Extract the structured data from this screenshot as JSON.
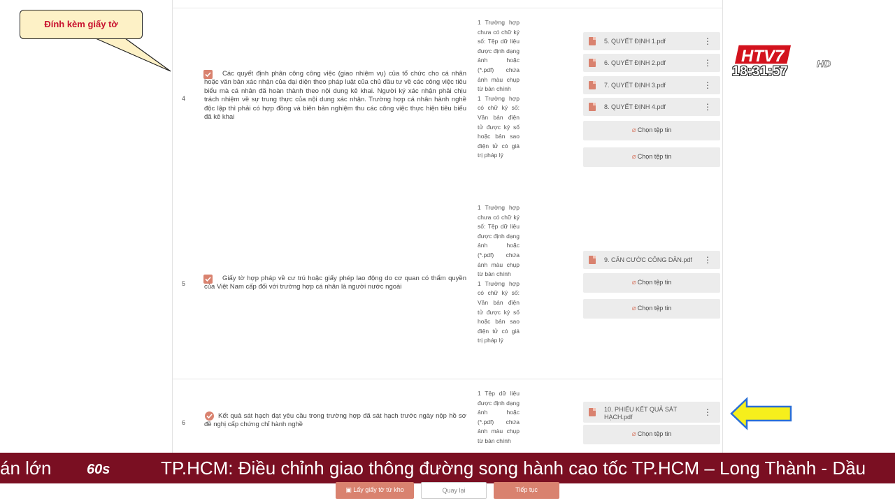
{
  "callout": {
    "label": "Đính kèm giấy tờ"
  },
  "channel": {
    "logo_text": "HTV7",
    "logo_suffix": "HD",
    "clock": "18:31:57"
  },
  "rows": [
    {
      "index": "4",
      "description": "Các quyết định phân công công việc (giao nhiệm vụ) của tổ chức cho cá nhân hoặc văn bản xác nhận của đại diện theo pháp luật của chủ đầu tư về các công việc tiêu biểu mà cá nhân đã hoàn thành theo nội dung kê khai. Người ký xác nhận phải chịu trách nhiệm về sự trung thực của nội dung xác nhận. Trường hợp cá nhân hành nghề độc lập thì phải có hợp đồng và biên bản nghiệm thu các công việc thực hiện tiêu biểu đã kê khai",
      "requirements": "1 Trường hợp chưa có chữ ký số: Tệp dữ liệu được định dạng ảnh hoặc (*.pdf) chứa ảnh màu chụp từ bản chính\n1 Trường hợp có chữ ký số: Văn bản điện tử được ký số hoặc bản sao điện tử có giá trị pháp lý",
      "files": [
        "5. QUYẾT ĐỊNH 1.pdf",
        "6. QUYẾT ĐỊNH 2.pdf",
        "7. QUYẾT ĐỊNH 3.pdf",
        "8. QUYẾT ĐỊNH 4.pdf"
      ],
      "choose_buttons": [
        "Chọn tệp tin",
        "Chọn tệp tin"
      ]
    },
    {
      "index": "5",
      "description": "Giấy tờ hợp pháp về cư trú hoặc giấy phép lao động do cơ quan có thẩm quyền của Việt Nam cấp đối với trường hợp cá nhân là người nước ngoài",
      "requirements": "1 Trường hợp chưa có chữ ký số: Tệp dữ liệu được định dạng ảnh hoặc (*.pdf) chứa ảnh màu chụp từ bản chính\n1 Trường hợp có chữ ký số: Văn bản điện tử được ký số hoặc bản sao điện tử có giá trị pháp lý",
      "files": [
        "9. CĂN CƯỚC CÔNG DÂN.pdf"
      ],
      "choose_buttons": [
        "Chọn tệp tin",
        "Chọn tệp tin"
      ]
    },
    {
      "index": "6",
      "description": "Kết quả sát hạch đạt yêu cầu trong trường hợp đã sát hạch trước ngày nộp hồ sơ đề nghị cấp chứng chỉ hành nghề",
      "requirements": "1 Tệp dữ liệu được định dạng ảnh hoặc (*.pdf) chứa ảnh màu chụp từ bản chính",
      "files": [
        "10. PHIẾU KẾT QUẢ SÁT HẠCH.pdf"
      ],
      "choose_buttons": [
        "Chọn tệp tin"
      ]
    }
  ],
  "ticker": {
    "left_fragment": "án lớn",
    "brand": "60s",
    "headline": "TP.HCM: Điều chỉnh giao thông đường song hành cao tốc TP.HCM – Long Thành - Dầu"
  },
  "footer": {
    "fetch_label": "Lấy giấy tờ từ kho",
    "back_label": "Quay lại",
    "next_label": "Tiếp tục"
  },
  "colors": {
    "accent": "#d9826f",
    "ticker_bg": "#7a0f22",
    "callout_bg": "#fdf1c6",
    "callout_text": "#c8102e",
    "arrow": "#f6ef1c"
  }
}
